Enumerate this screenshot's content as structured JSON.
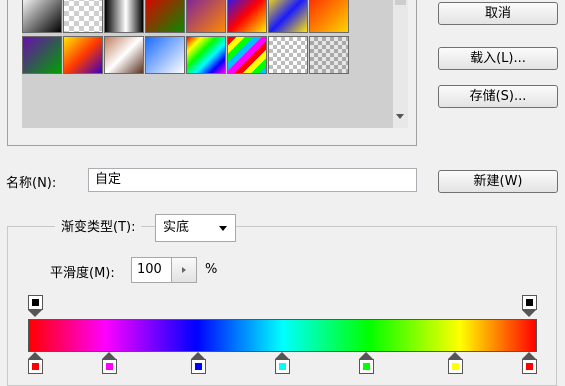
{
  "presets": {
    "swatches": [
      "linear-gradient(135deg,#ffffff,#000000)",
      "repeating-conic-gradient(#cfcfcf 0 25%,#ffffff 0 50%) 0 0/10px 10px",
      "linear-gradient(90deg,#000000,#ffffff 55%,#000000)",
      "linear-gradient(135deg,#e00000,#0a8a00)",
      "linear-gradient(135deg,#7b1fa2,#ff8a00)",
      "linear-gradient(135deg,#1a1aff,#ff0000,#ffee00)",
      "linear-gradient(135deg,#ffe600,#1a1aff,#ffe600)",
      "linear-gradient(135deg,#ff2a00,#ffd400)",
      "linear-gradient(135deg,#6a0dad,#00a000)",
      "linear-gradient(135deg,#ffe600,#ff3b00,#3a00c0)",
      "linear-gradient(135deg,#c08060,#ffffff,#5a3020)",
      "linear-gradient(135deg,#1a6bff,#ffffff)",
      "linear-gradient(135deg,#ff0000,#ffff00,#00ff00,#00ffff,#0000ff,#ff00ff)",
      "repeating-linear-gradient(135deg,#ff0000 0 6px,#ffff00 6px 12px,#00ff00 12px 18px,#00c0ff 18px 24px,#ff00ff 24px 30px)",
      "repeating-conic-gradient(#bdbdbd 0 25%,#ffffff 0 50%) 0 0/8px 8px",
      "repeating-conic-gradient(#a8a8a8 0 25%,#e6e6e6 0 50%) 0 0/8px 8px"
    ]
  },
  "buttons": {
    "cancel": "取消",
    "load": "载入(L)...",
    "save": "存储(S)...",
    "new": "新建(W)"
  },
  "name": {
    "label": "名称(N):",
    "value": "自定"
  },
  "gradient": {
    "type_label": "渐变类型(T):",
    "type_value": "实底",
    "smoothness_label": "平滑度(M):",
    "smoothness_value": "100",
    "smoothness_unit": "%",
    "bar": "linear-gradient(90deg,#ff0000 0%,#ff00ff 15%,#0000ff 33%,#00ffff 50%,#00ff00 67%,#ffff00 85%,#ff0000 100%)",
    "opacity_stops": [
      {
        "location": 0,
        "color": "#000000"
      },
      {
        "location": 100,
        "color": "#000000"
      }
    ],
    "color_stops": [
      {
        "location": 0,
        "color": "#ff0000"
      },
      {
        "location": 15,
        "color": "#ff00ff"
      },
      {
        "location": 33,
        "color": "#0000ff"
      },
      {
        "location": 50,
        "color": "#00ffff"
      },
      {
        "location": 67,
        "color": "#00ff00"
      },
      {
        "location": 85,
        "color": "#ffff00"
      },
      {
        "location": 100,
        "color": "#ff0000"
      }
    ]
  }
}
